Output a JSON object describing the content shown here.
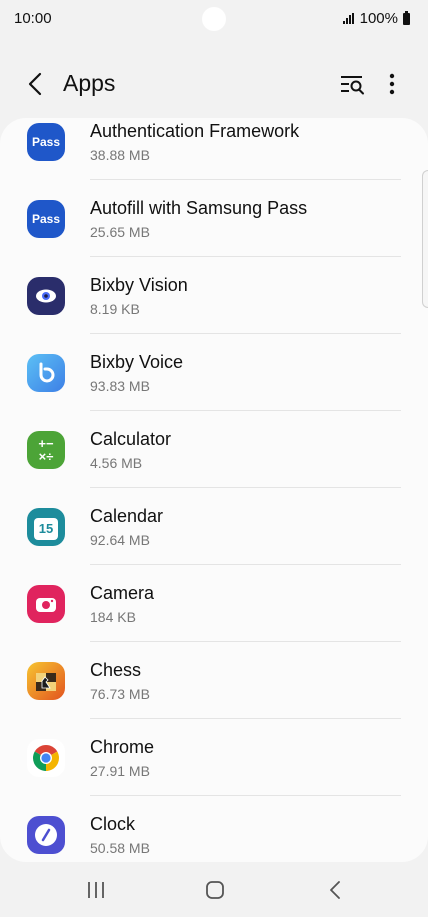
{
  "status_bar": {
    "time": "10:00",
    "battery": "100%"
  },
  "header": {
    "title": "Apps"
  },
  "apps": [
    {
      "name": "Authentication Framework",
      "size": "38.88 MB",
      "icon": "samsung-pass-icon",
      "icon_text": "Pass"
    },
    {
      "name": "Autofill with Samsung Pass",
      "size": "25.65 MB",
      "icon": "samsung-pass-icon",
      "icon_text": "Pass"
    },
    {
      "name": "Bixby Vision",
      "size": "8.19 KB",
      "icon": "eye-icon"
    },
    {
      "name": "Bixby Voice",
      "size": "93.83 MB",
      "icon": "bixby-b-icon"
    },
    {
      "name": "Calculator",
      "size": "4.56 MB",
      "icon": "calculator-icon",
      "icon_text": "+−\n×÷"
    },
    {
      "name": "Calendar",
      "size": "92.64 MB",
      "icon": "calendar-icon",
      "icon_text": "15"
    },
    {
      "name": "Camera",
      "size": "184 KB",
      "icon": "camera-icon"
    },
    {
      "name": "Chess",
      "size": "76.73 MB",
      "icon": "chess-icon"
    },
    {
      "name": "Chrome",
      "size": "27.91 MB",
      "icon": "chrome-icon"
    },
    {
      "name": "Clock",
      "size": "50.58 MB",
      "icon": "clock-icon"
    }
  ],
  "colors": {
    "pass_blue": "#1f57c9",
    "bixby_vision": "#2a2d6b",
    "bixby_voice": "#4aa3f0",
    "calculator": "#4ca437",
    "calendar": "#1d8c9c",
    "camera": "#e0245e",
    "clock": "#4d4fd1"
  }
}
